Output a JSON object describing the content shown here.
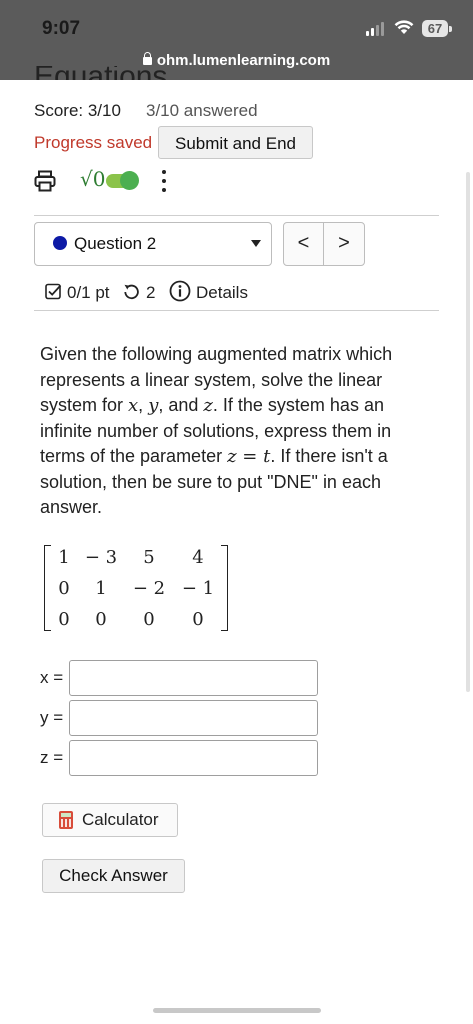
{
  "status": {
    "time": "9:07",
    "battery": "67",
    "url": "ohm.lumenlearning.com"
  },
  "page": {
    "clipped_heading": "Equations"
  },
  "header": {
    "score": "Score: 3/10",
    "answered": "3/10 answered",
    "progress_saved": "Progress saved",
    "submit_label": "Submit and End",
    "sqrt_label": "√0"
  },
  "question_nav": {
    "selected": "Question 2",
    "prev": "<",
    "next": ">"
  },
  "meta": {
    "points": "0/1 pt",
    "retries": "2",
    "details": "Details"
  },
  "question": {
    "p1": "Given the following augmented matrix which represents a linear system, solve the linear system for ",
    "var_x": "x",
    "sep1": ", ",
    "var_y": "y",
    "sep2": ", and ",
    "var_z": "z",
    "p2": ". If the system has an infinite number of solutions, express them in terms of the parameter ",
    "param_expr": "z = t",
    "p3": ". If there isn't a solution, then be sure to put \"DNE\" in each answer."
  },
  "matrix": {
    "rows": [
      [
        "1",
        "− 3",
        "5",
        "4"
      ],
      [
        "0",
        "1",
        "− 2",
        "− 1"
      ],
      [
        "0",
        "0",
        "0",
        "0"
      ]
    ]
  },
  "answers": [
    {
      "label": "x =",
      "value": ""
    },
    {
      "label": "y =",
      "value": ""
    },
    {
      "label": "z =",
      "value": ""
    }
  ],
  "buttons": {
    "calculator": "Calculator",
    "check_answer": "Check Answer"
  },
  "colors": {
    "topbar": "#5b5b5b",
    "progress_saved": "#c0392b",
    "question_dot": "#0d1aa6",
    "toggle": "#4caf50"
  }
}
